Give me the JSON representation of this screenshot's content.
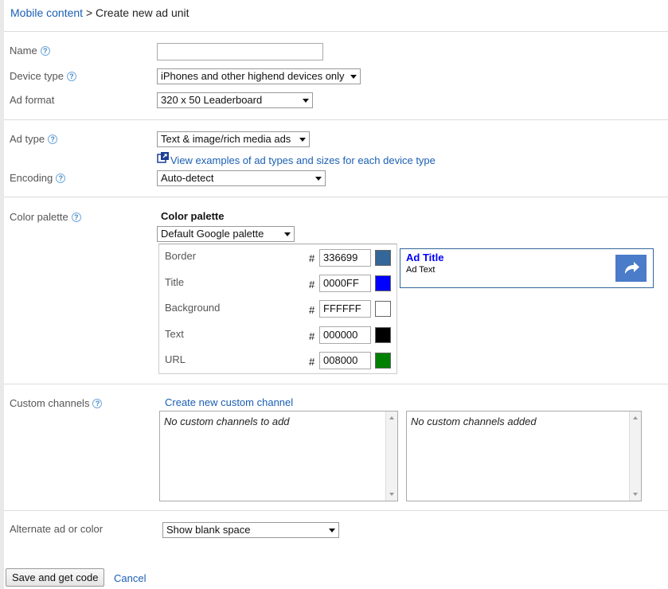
{
  "breadcrumb": {
    "parent": "Mobile content",
    "separator": " > ",
    "current": "Create new ad unit"
  },
  "form": {
    "name": {
      "label": "Name",
      "value": ""
    },
    "device_type": {
      "label": "Device type",
      "value": "iPhones and other highend devices only"
    },
    "ad_format": {
      "label": "Ad format",
      "value": "320 x 50 Leaderboard"
    },
    "ad_type": {
      "label": "Ad type",
      "value": "Text & image/rich media ads",
      "examples_link": "View examples of ad types and sizes for each device type"
    },
    "encoding": {
      "label": "Encoding",
      "value": "Auto-detect"
    },
    "color_palette": {
      "label": "Color palette",
      "heading": "Color palette",
      "value": "Default Google palette",
      "hash_symbol": "#",
      "rows": [
        {
          "label": "Border",
          "hex": "336699",
          "color": "#336699"
        },
        {
          "label": "Title",
          "hex": "0000FF",
          "color": "#0000FF"
        },
        {
          "label": "Background",
          "hex": "FFFFFF",
          "color": "#FFFFFF"
        },
        {
          "label": "Text",
          "hex": "000000",
          "color": "#000000"
        },
        {
          "label": "URL",
          "hex": "008000",
          "color": "#008000"
        }
      ],
      "preview": {
        "title": "Ad Title",
        "text": "Ad Text",
        "button_color": "#4a7cc9"
      }
    },
    "custom_channels": {
      "label": "Custom channels",
      "create_link": "Create new custom channel",
      "available_empty": "No custom channels to add",
      "added_empty": "No custom channels added"
    },
    "alternate": {
      "label": "Alternate ad or color",
      "value": "Show blank space"
    }
  },
  "actions": {
    "save_label": "Save and get code",
    "cancel_label": "Cancel"
  },
  "icons": {
    "help": "help-icon",
    "external": "external-link-icon",
    "share_arrow": "share-arrow-icon"
  }
}
